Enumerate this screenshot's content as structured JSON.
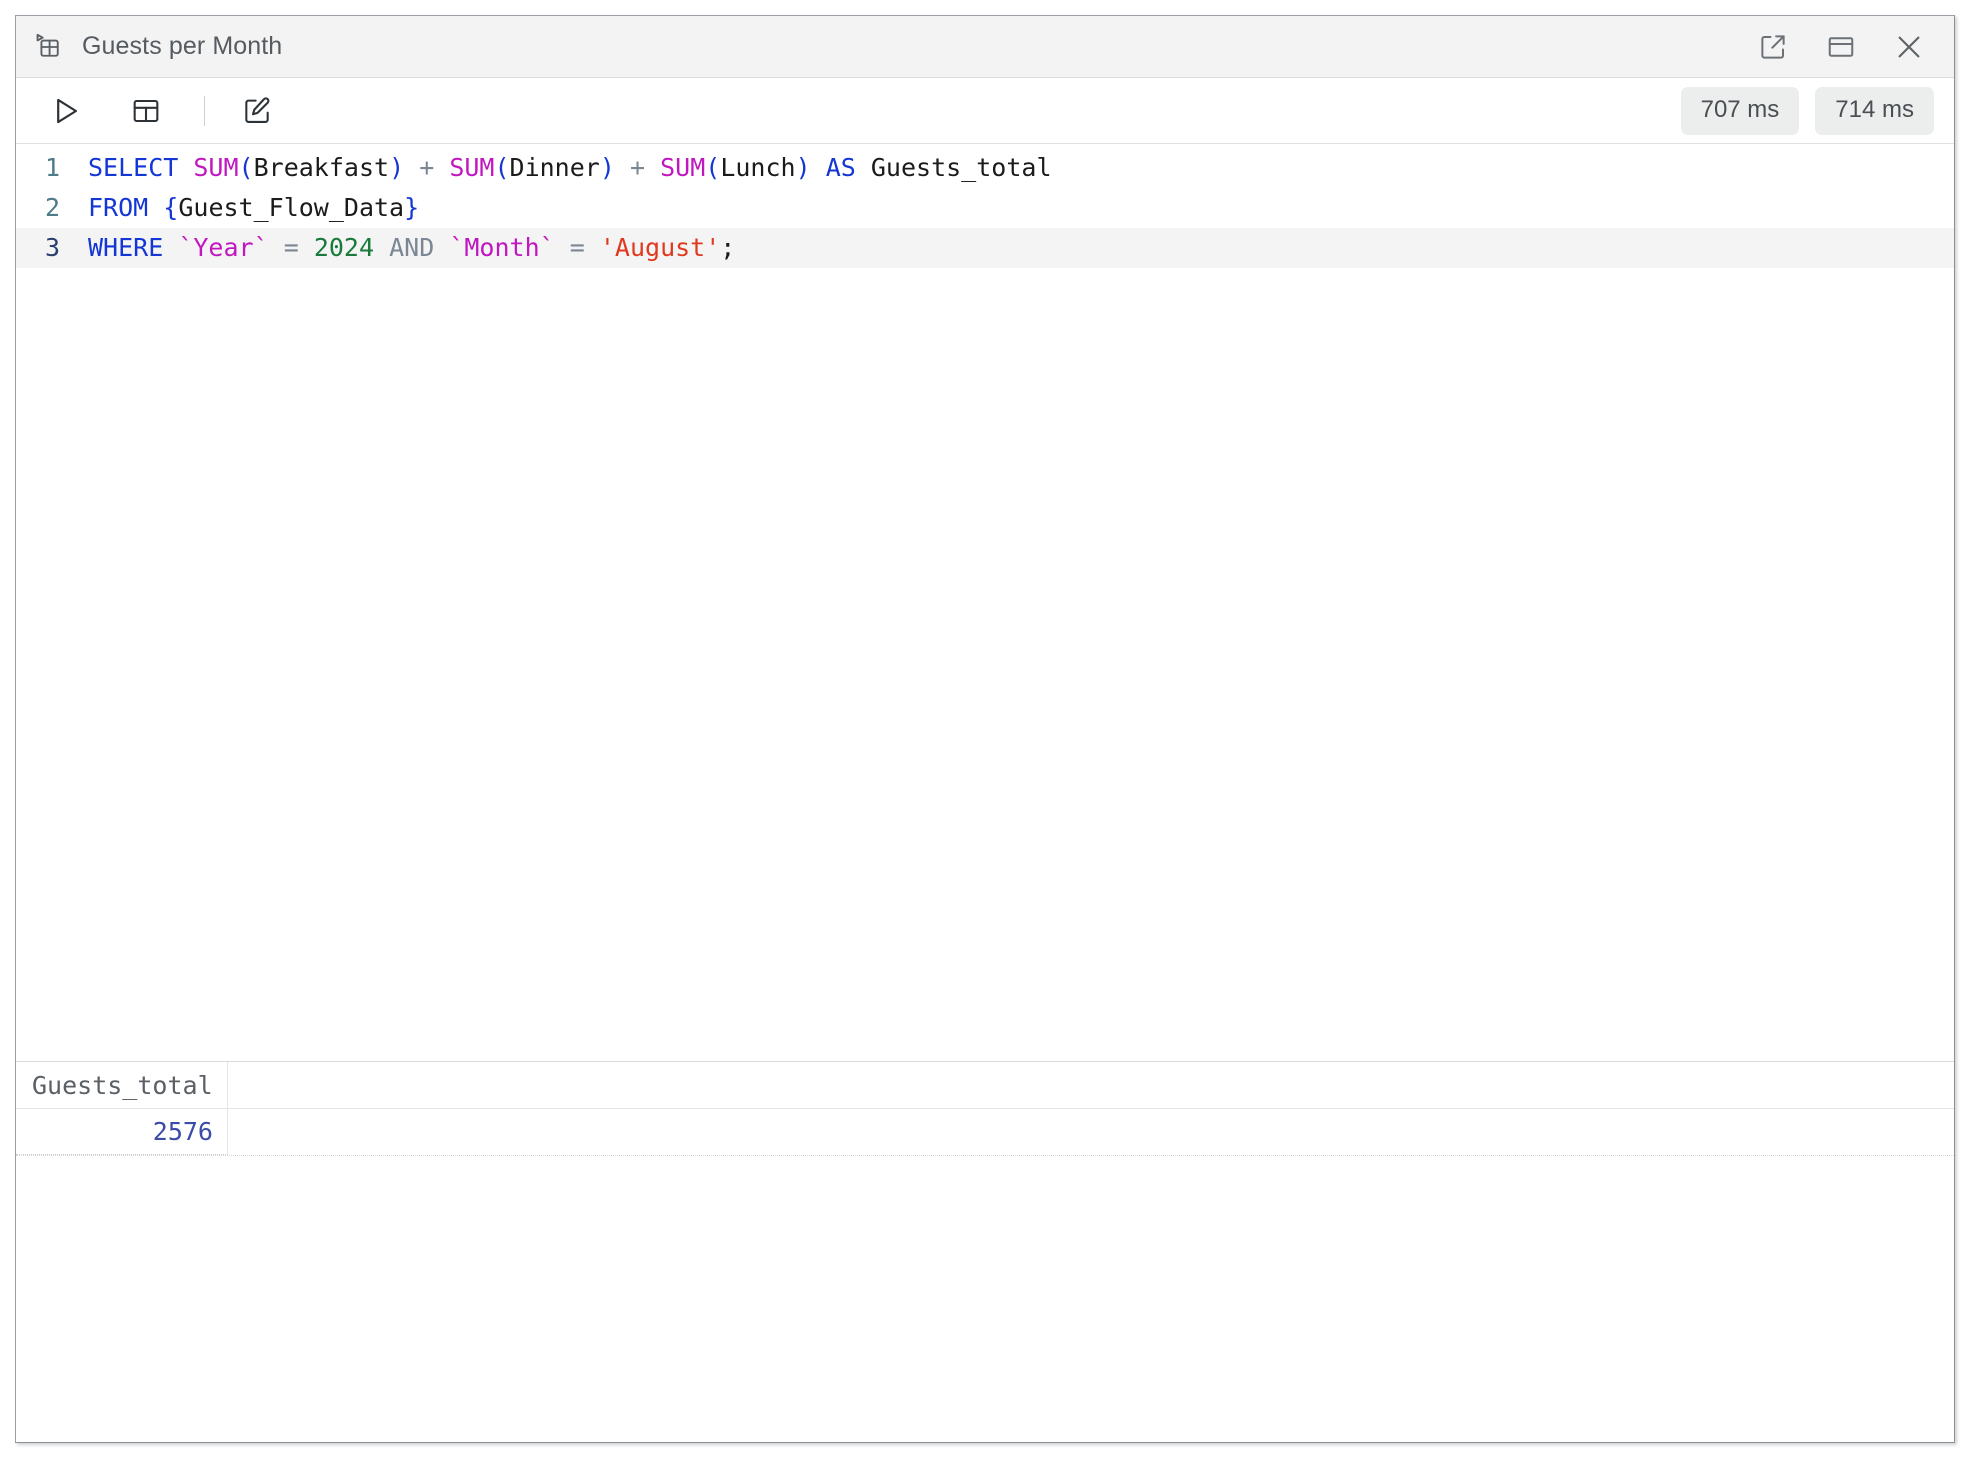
{
  "window": {
    "title": "Guests per Month",
    "title_icon": "table-run-icon",
    "controls": [
      {
        "name": "open-external-button",
        "icon": "external-link-icon",
        "label": "Open in new window"
      },
      {
        "name": "split-panel-button",
        "icon": "panel-layout-icon",
        "label": "Toggle panel layout"
      },
      {
        "name": "close-button",
        "icon": "close-icon",
        "label": "Close"
      }
    ]
  },
  "toolbar": {
    "run_icon": "play-icon",
    "run_label": "Run query",
    "table_icon": "table-icon",
    "table_label": "Show table",
    "edit_icon": "pencil-edit-icon",
    "edit_label": "Edit query",
    "timings": [
      {
        "name": "timing-badge-compile",
        "value": "707 ms"
      },
      {
        "name": "timing-badge-total",
        "value": "714 ms"
      }
    ]
  },
  "editor": {
    "language": "sql",
    "active_line": 3,
    "lines": [
      {
        "number": "1",
        "tokens": [
          {
            "t": "SELECT",
            "c": "kw"
          },
          {
            "t": " ",
            "c": "pln"
          },
          {
            "t": "SUM",
            "c": "fn"
          },
          {
            "t": "(",
            "c": "par"
          },
          {
            "t": "Breakfast",
            "c": "id"
          },
          {
            "t": ")",
            "c": "par"
          },
          {
            "t": " ",
            "c": "pln"
          },
          {
            "t": "+",
            "c": "op"
          },
          {
            "t": " ",
            "c": "pln"
          },
          {
            "t": "SUM",
            "c": "fn"
          },
          {
            "t": "(",
            "c": "par"
          },
          {
            "t": "Dinner",
            "c": "id"
          },
          {
            "t": ")",
            "c": "par"
          },
          {
            "t": " ",
            "c": "pln"
          },
          {
            "t": "+",
            "c": "op"
          },
          {
            "t": " ",
            "c": "pln"
          },
          {
            "t": "SUM",
            "c": "fn"
          },
          {
            "t": "(",
            "c": "par"
          },
          {
            "t": "Lunch",
            "c": "id"
          },
          {
            "t": ")",
            "c": "par"
          },
          {
            "t": " ",
            "c": "pln"
          },
          {
            "t": "AS",
            "c": "kw"
          },
          {
            "t": " ",
            "c": "pln"
          },
          {
            "t": "Guests_total",
            "c": "id"
          }
        ]
      },
      {
        "number": "2",
        "tokens": [
          {
            "t": "FROM",
            "c": "kw"
          },
          {
            "t": " ",
            "c": "pln"
          },
          {
            "t": "{",
            "c": "par"
          },
          {
            "t": "Guest_Flow_Data",
            "c": "id"
          },
          {
            "t": "}",
            "c": "par"
          }
        ]
      },
      {
        "number": "3",
        "tokens": [
          {
            "t": "WHERE",
            "c": "kw"
          },
          {
            "t": " ",
            "c": "pln"
          },
          {
            "t": "`Year`",
            "c": "col"
          },
          {
            "t": " ",
            "c": "pln"
          },
          {
            "t": "=",
            "c": "op"
          },
          {
            "t": " ",
            "c": "pln"
          },
          {
            "t": "2024",
            "c": "num"
          },
          {
            "t": " ",
            "c": "pln"
          },
          {
            "t": "AND",
            "c": "op"
          },
          {
            "t": " ",
            "c": "pln"
          },
          {
            "t": "`Month`",
            "c": "col"
          },
          {
            "t": " ",
            "c": "pln"
          },
          {
            "t": "=",
            "c": "op"
          },
          {
            "t": " ",
            "c": "pln"
          },
          {
            "t": "'August'",
            "c": "str"
          },
          {
            "t": ";",
            "c": "pln"
          }
        ]
      }
    ],
    "plain_text": "SELECT SUM(Breakfast) + SUM(Dinner) + SUM(Lunch) AS Guests_total\nFROM {Guest_Flow_Data}\nWHERE `Year` = 2024 AND `Month` = 'August';"
  },
  "results": {
    "columns": [
      "Guests_total"
    ],
    "rows": [
      [
        "2576"
      ]
    ]
  },
  "colors": {
    "keyword": "#1436d4",
    "function": "#c117c1",
    "string": "#e0391f",
    "number": "#1a7a3c",
    "operator": "#7b8794",
    "result_value": "#3b4ba8",
    "titlebar_bg": "#f3f3f3",
    "active_line_bg": "#f4f4f4"
  }
}
